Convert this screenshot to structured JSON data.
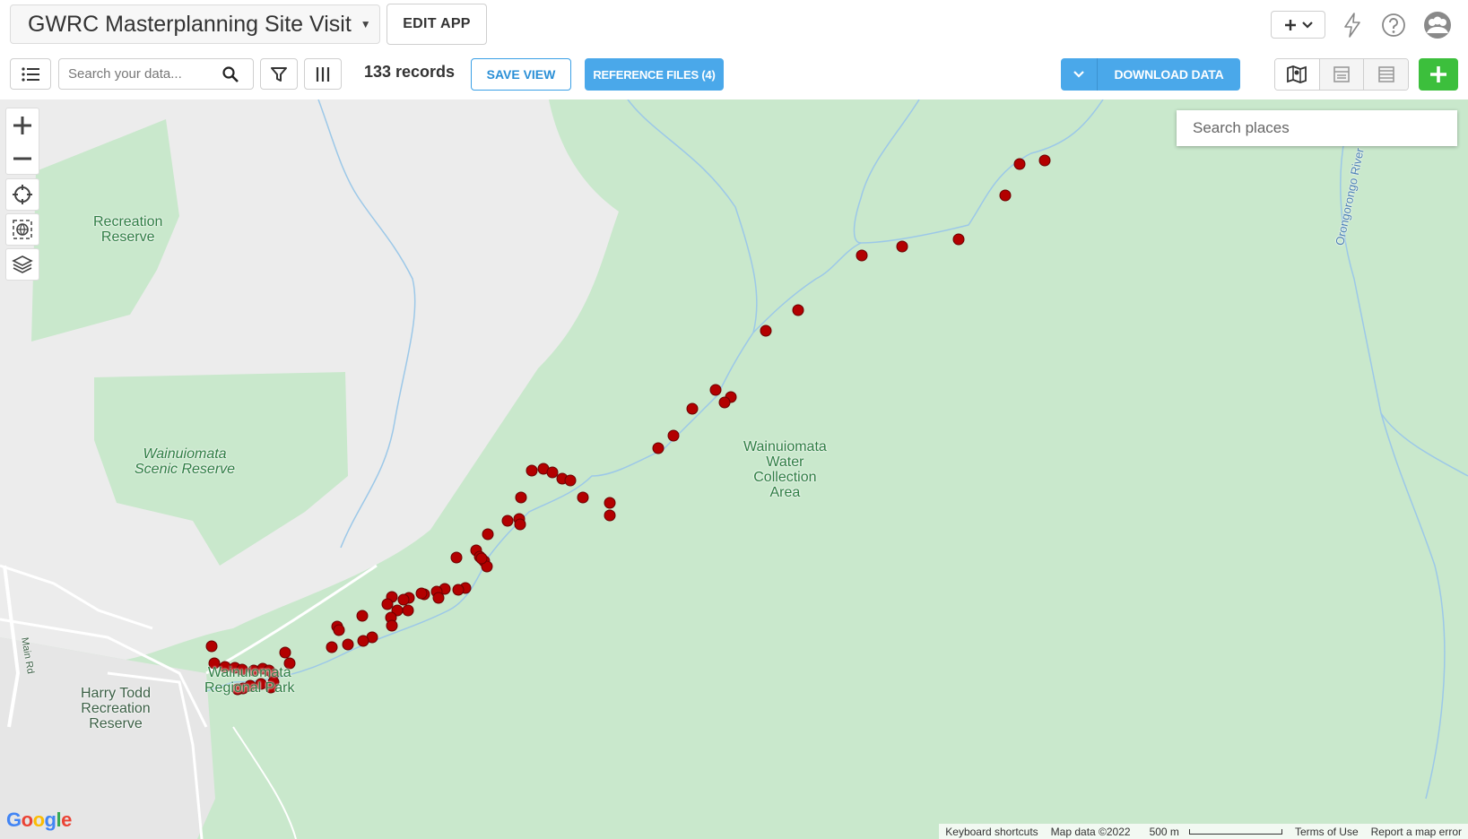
{
  "app": {
    "title": "GWRC Masterplanning Site Visit",
    "edit_label": "EDIT APP"
  },
  "toolbar": {
    "search_placeholder": "Search your data...",
    "records": "133 records",
    "save_view": "SAVE VIEW",
    "reference_files": "REFERENCE FILES (4)",
    "download": "DOWNLOAD DATA"
  },
  "map": {
    "places_placeholder": "Search places",
    "labels": {
      "recreation_reserve": [
        "Recreation",
        "Reserve"
      ],
      "scenic_reserve": [
        "Wainuiomata",
        "Scenic Reserve"
      ],
      "water_collection": [
        "Wainuiomata",
        "Water",
        "Collection",
        "Area"
      ],
      "regional_park": [
        "Wainuiomata",
        "Regional Park"
      ],
      "harry_todd": [
        "Harry Todd",
        "Recreation",
        "Reserve"
      ],
      "river": "Orongorongo River",
      "road": "Main Rd"
    },
    "attribution": {
      "shortcuts": "Keyboard shortcuts",
      "map_data": "Map data ©2022",
      "scale": "500 m",
      "terms": "Terms of Use",
      "report": "Report a map error"
    },
    "logo": "Google",
    "marker_color": "#b30000"
  },
  "colors": {
    "accent": "#4aa8ea",
    "add": "#3cbf3c",
    "park": "#c9e8cc",
    "urban": "#ececec"
  }
}
